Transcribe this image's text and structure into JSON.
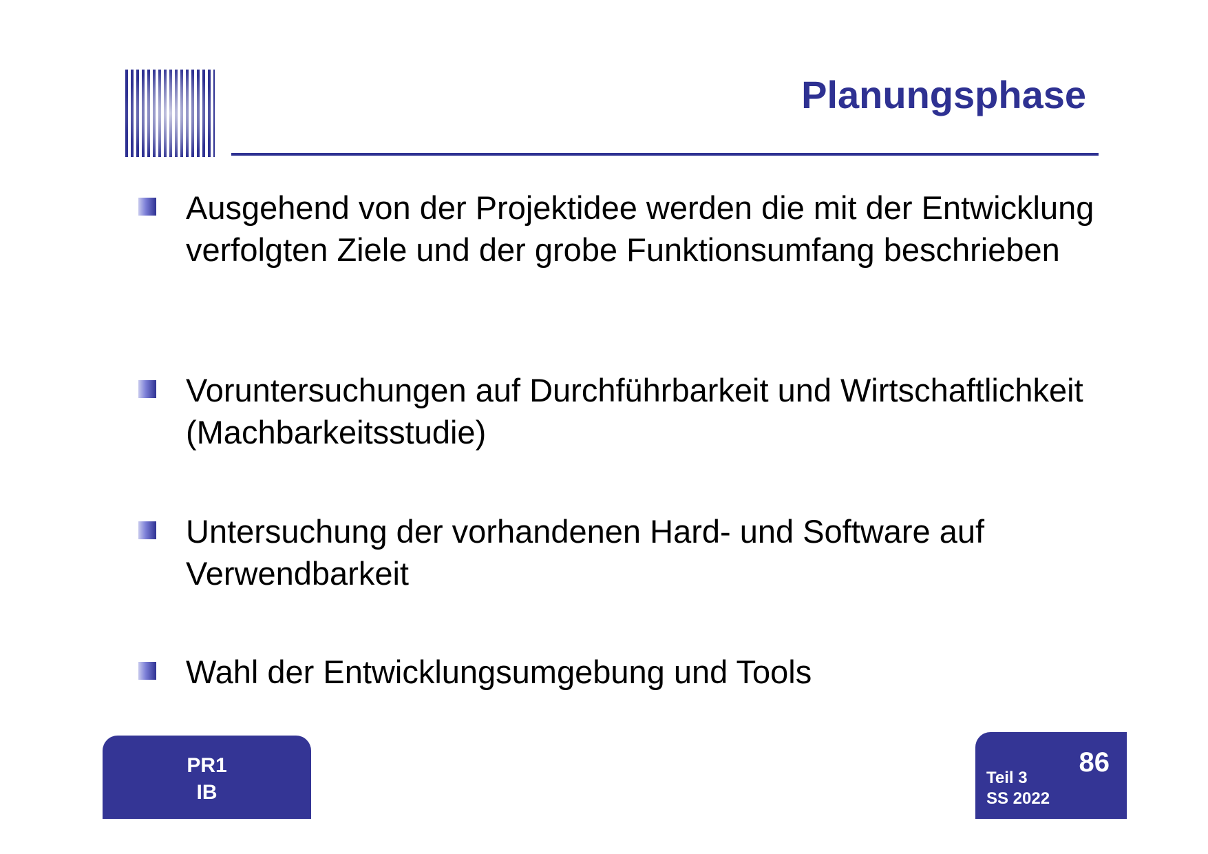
{
  "slide": {
    "title": "Planungsphase",
    "bullets": [
      "Ausgehend von der Projektidee werden die mit der Entwicklung verfolgten Ziele und der grobe Funktionsumfang beschrieben",
      "Voruntersuchungen auf Durchführbarkeit und Wirtschaftlichkeit (Machbarkeitsstudie)",
      "Untersuchung der vorhandenen Hard- und Software auf Verwendbarkeit",
      "Wahl der Entwicklungsumgebung und Tools"
    ]
  },
  "footer": {
    "course": "PR1",
    "program": "IB",
    "page_number": "86",
    "part": "Teil 3",
    "term": "SS 2022"
  },
  "colors": {
    "accent": "#2e3192",
    "footer_box": "#343595",
    "text": "#000000"
  },
  "icons": {
    "logo": "institution-logo-grid",
    "bullet": "square-bullet-icon"
  }
}
